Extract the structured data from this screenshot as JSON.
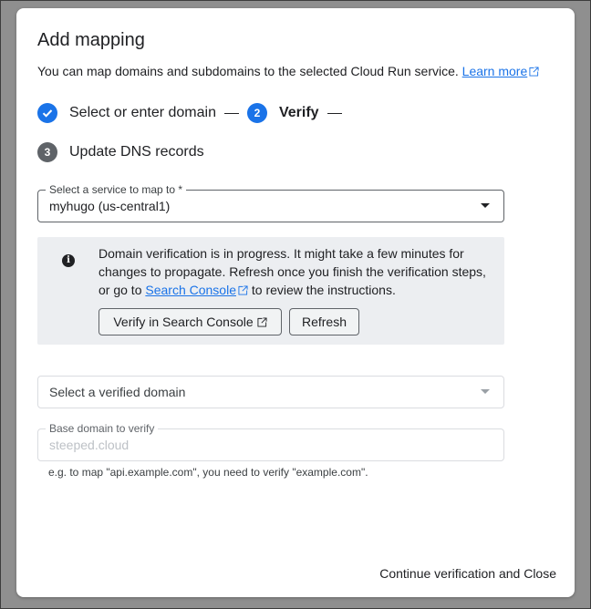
{
  "dialog": {
    "title": "Add mapping",
    "subtitle": "You can map domains and subdomains to the selected Cloud Run service.",
    "learn_more": "Learn more"
  },
  "stepper": {
    "steps": [
      {
        "label": "Select or enter domain",
        "status": "done"
      },
      {
        "number": "2",
        "label": "Verify",
        "status": "active"
      },
      {
        "number": "3",
        "label": "Update DNS records",
        "status": "pending"
      }
    ]
  },
  "service_select": {
    "label": "Select a service to map to *",
    "value": "myhugo (us-central1)"
  },
  "info": {
    "text_before": "Domain verification is in progress. It might take a few minutes for changes to propagate. Refresh once you finish the verification steps, or go to ",
    "link": "Search Console",
    "text_after": " to review the instructions.",
    "verify_button": "Verify in Search Console",
    "refresh_button": "Refresh"
  },
  "domain_select": {
    "placeholder": "Select a verified domain"
  },
  "base_domain": {
    "label": "Base domain to verify",
    "placeholder": "steeped.cloud",
    "hint": "e.g. to map \"api.example.com\", you need to verify \"example.com\"."
  },
  "footer": {
    "continue_button": "Continue verification and Close"
  },
  "colors": {
    "accent": "#1a73e8",
    "info_bg": "#eceef1",
    "backdrop": "#8f8f8f"
  }
}
